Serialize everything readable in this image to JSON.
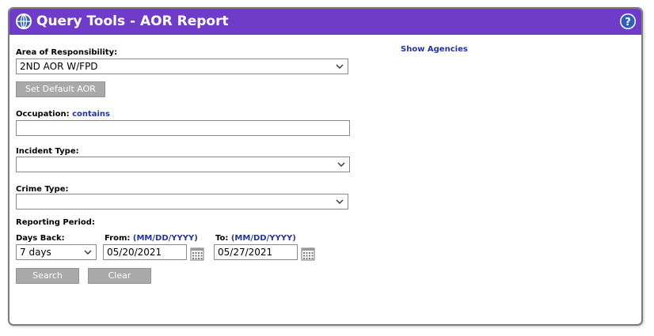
{
  "header": {
    "title": "Query Tools - AOR Report",
    "icon": "globe-icon",
    "help_icon": "help-icon",
    "bar_color": "#6e3cc8"
  },
  "aor": {
    "label": "Area of Responsibility:",
    "value": "2ND AOR W/FPD",
    "set_default_label": "Set Default AOR"
  },
  "show_agencies_label": "Show Agencies",
  "occupation": {
    "label": "Occupation:",
    "modifier": "contains",
    "value": ""
  },
  "incident_type": {
    "label": "Incident Type:",
    "value": ""
  },
  "crime_type": {
    "label": "Crime Type:",
    "value": ""
  },
  "reporting_period": {
    "label": "Reporting Period:",
    "days_back_label": "Days Back:",
    "days_back_value": "7 days",
    "from_label": "From:",
    "from_format": "(MM/DD/YYYY)",
    "from_value": "05/20/2021",
    "to_label": "To:",
    "to_format": "(MM/DD/YYYY)",
    "to_value": "05/27/2021",
    "calendar_icon": "calendar-icon"
  },
  "actions": {
    "search_label": "Search",
    "clear_label": "Clear"
  },
  "colors": {
    "link": "#2233aa",
    "button": "#a9a9a9"
  }
}
